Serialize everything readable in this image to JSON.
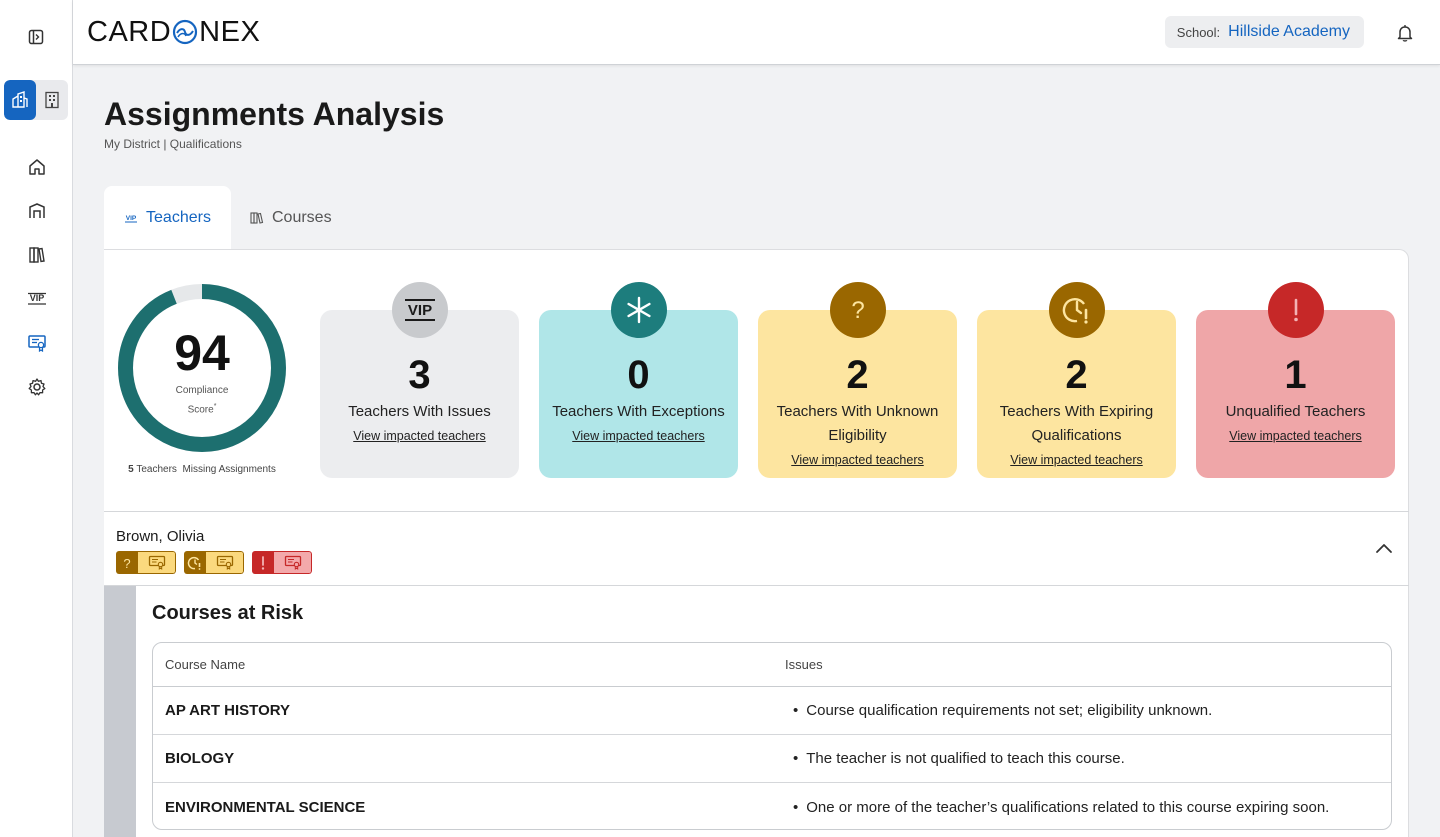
{
  "app": {
    "logo_text_left": "CARD",
    "logo_text_right": "NEX",
    "school_label": "School:",
    "school_value": "Hillside Academy"
  },
  "sidebar": {
    "items": [
      {
        "icon": "home-icon"
      },
      {
        "icon": "building-icon"
      },
      {
        "icon": "books-icon"
      },
      {
        "icon": "vip-icon"
      },
      {
        "icon": "certificate-icon"
      },
      {
        "icon": "gear-icon"
      }
    ]
  },
  "page": {
    "title": "Assignments Analysis",
    "breadcrumb": "My District | Qualifications"
  },
  "tabs": [
    {
      "label": "Teachers",
      "active": true
    },
    {
      "label": "Courses",
      "active": false
    }
  ],
  "compliance": {
    "score": "94",
    "score_fraction": 0.94,
    "caption_line1": "Compliance",
    "caption_line2": "Score",
    "caption_mark": "*",
    "missing_count": "5",
    "missing_label": "Teachers  Missing Assignments",
    "ring_color": "#1d6f6f",
    "track_color": "#e6e8ea"
  },
  "cards": [
    {
      "value": "3",
      "title": "Teachers With Issues",
      "link": "View impacted teachers",
      "icon": "vip-icon"
    },
    {
      "value": "0",
      "title": "Teachers With Exceptions",
      "link": "View impacted teachers",
      "icon": "asterisk-icon"
    },
    {
      "value": "2",
      "title": "Teachers With Unknown Eligibility",
      "link": "View impacted teachers",
      "icon": "question-icon"
    },
    {
      "value": "2",
      "title": "Teachers With Expiring Qualifications",
      "link": "View impacted teachers",
      "icon": "clock-alert-icon"
    },
    {
      "value": "1",
      "title": "Unqualified Teachers",
      "link": "View impacted teachers",
      "icon": "exclamation-icon"
    }
  ],
  "teacher": {
    "name": "Brown, Olivia",
    "badges": [
      {
        "glyph": "?",
        "tone": "amber"
      },
      {
        "glyph": "clock",
        "tone": "amber"
      },
      {
        "glyph": "!",
        "tone": "red"
      }
    ]
  },
  "courses_at_risk": {
    "title": "Courses at Risk",
    "headers": [
      "Course Name",
      "Issues"
    ],
    "rows": [
      {
        "course": "AP ART HISTORY",
        "issue": "Course qualification requirements not set; eligibility unknown."
      },
      {
        "course": "BIOLOGY",
        "issue": "The teacher is not qualified to teach this course."
      },
      {
        "course": "ENVIRONMENTAL SCIENCE",
        "issue": "One or more of the teacher’s qualifications related to this course expiring soon."
      }
    ]
  }
}
